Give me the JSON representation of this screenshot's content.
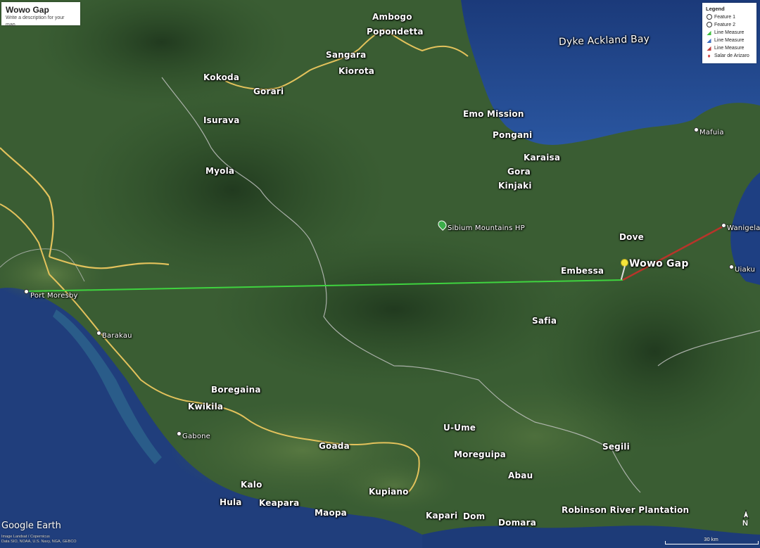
{
  "title_box": {
    "title": "Wowo Gap",
    "description": "Write a description for your map."
  },
  "legend": {
    "heading": "Legend",
    "items": [
      {
        "label": "Feature 1",
        "icon": "hollow-circle-icon"
      },
      {
        "label": "Feature 2",
        "icon": "hollow-circle-icon"
      },
      {
        "label": "Line Measure",
        "icon": "green-line-icon",
        "color": "#3fbf3f"
      },
      {
        "label": "Line Measure",
        "icon": "blue-line-icon",
        "color": "#3f6fbf"
      },
      {
        "label": "Line Measure",
        "icon": "red-line-icon",
        "color": "#bf3f3f"
      },
      {
        "label": "Salar de Arizaro",
        "icon": "red-pin-icon",
        "color": "#cc3333"
      }
    ]
  },
  "places": {
    "ambogo": "Ambogo",
    "popondetta": "Popondetta",
    "dyke_ackland_bay": "Dyke Ackland Bay",
    "sangara": "Sangara",
    "kiorota": "Kiorota",
    "kokoda": "Kokoda",
    "gorari": "Gorari",
    "isurava": "Isurava",
    "myola": "Myola",
    "emo_mission": "Emo Mission",
    "pongani": "Pongani",
    "mafuia": "Mafuia",
    "karaisa": "Karaisa",
    "gora": "Gora",
    "kinjaki": "Kinjaki",
    "sibium": "Sibium Mountains HP",
    "wanigela": "Wanigela",
    "dove": "Dove",
    "wowo_gap": "Wowo Gap",
    "uiaku": "Uiaku",
    "embessa": "Embessa",
    "port_moresby": "Port Moresby",
    "barakau": "Barakau",
    "safia": "Safia",
    "boregaina": "Boregaina",
    "kwikila": "Kwikila",
    "gabone": "Gabone",
    "u_ume": "U-Ume",
    "goada": "Goada",
    "segili": "Segili",
    "moreguipa": "Moreguipa",
    "abau": "Abau",
    "kalo": "Kalo",
    "hula": "Hula",
    "keapara": "Keapara",
    "maopa": "Maopa",
    "kupiano": "Kupiano",
    "robinson": "Robinson River Plantation",
    "kapari": "Kapari",
    "dom": "Dom",
    "domara": "Domara"
  },
  "watermark": "Google Earth",
  "credits": [
    "Image Landsat / Copernicus",
    "Data SIO, NOAA, U.S. Navy, NGA, GEBCO"
  ],
  "scale_label": "30 km",
  "north_label": "N",
  "colors": {
    "measure_green": "#3fd33f",
    "measure_red": "#b8342a",
    "road": "#e8c35a",
    "sea": "#1c3a78",
    "land": "#35562f",
    "pushpin": "#f5e53a"
  }
}
